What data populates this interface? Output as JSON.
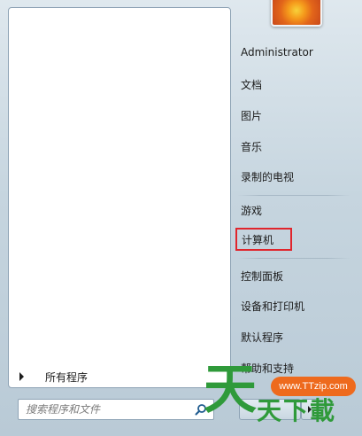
{
  "left_panel": {
    "all_programs_label": "所有程序",
    "search_placeholder": "搜索程序和文件"
  },
  "right_panel": {
    "user_name": "Administrator",
    "items": [
      {
        "label": "文档"
      },
      {
        "label": "图片"
      },
      {
        "label": "音乐"
      },
      {
        "label": "录制的电视"
      },
      {
        "label": "游戏"
      },
      {
        "label": "计算机"
      },
      {
        "label": "控制面板"
      },
      {
        "label": "设备和打印机"
      },
      {
        "label": "默认程序"
      },
      {
        "label": "帮助和支持"
      }
    ]
  },
  "watermark": {
    "site": "www.TTzip.com",
    "big_char": "天",
    "small_text": "天下載"
  },
  "colors": {
    "highlight_border": "#e0252c",
    "watermark_green": "#2f9a3a",
    "watermark_orange": "#ee6a1d"
  }
}
